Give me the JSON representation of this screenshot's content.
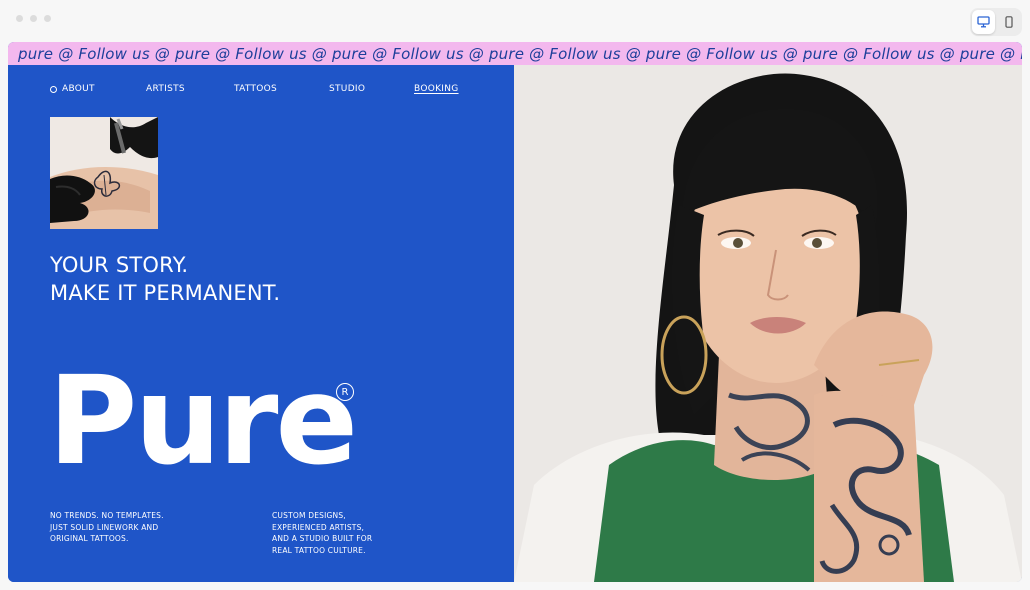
{
  "window": {
    "device_toggle": {
      "active": "desktop"
    }
  },
  "marquee": {
    "text": "pure @ Follow us @ pure @ Follow us @ pure @ Follow us @ pure @ Follow us @ pure @ Follow us @ pure @ Follow us @ pure @ Follow me @ pure @"
  },
  "nav": {
    "about": "ABOUT",
    "artists": "ARTISTS",
    "tattoos": "TATTOOS",
    "studio": "STUDIO",
    "booking": "BOOKING"
  },
  "hero": {
    "headline_line1": "YOUR STORY.",
    "headline_line2": "MAKE IT PERMANENT.",
    "logo": "Pure",
    "registered": "R"
  },
  "blurbs": {
    "one": [
      "NO TRENDS. NO TEMPLATES.",
      "JUST SOLID LINEWORK AND",
      "ORIGINAL TATTOOS."
    ],
    "two": [
      "CUSTOM DESIGNS,",
      "EXPERIENCED ARTISTS,",
      "AND A STUDIO BUILT FOR",
      "REAL TATTOO CULTURE."
    ]
  },
  "colors": {
    "brand_blue": "#1f55c8",
    "marquee_pink": "#f3b8ee",
    "marquee_text": "#1d3f9a"
  }
}
